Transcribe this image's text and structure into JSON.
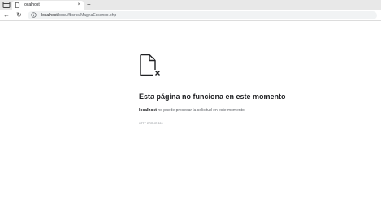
{
  "browser": {
    "tab": {
      "title": "localhost",
      "close_glyph": "×"
    },
    "new_tab_glyph": "+",
    "nav": {
      "back_glyph": "←",
      "reload_glyph": "↻"
    },
    "address": {
      "host": "localhost",
      "path": "/bosu/fbsrcs/MagnaEssenso.php"
    },
    "icons": [
      "tab-actions-icon",
      "page-favicon-icon",
      "info-icon",
      "back-arrow-icon",
      "reload-icon"
    ]
  },
  "error": {
    "icon": "broken-document-icon",
    "title": "Esta página no funciona en este momento",
    "host": "localhost",
    "message": " no puede procesar la solicitud en este momento.",
    "code": "HTTP ERROR 500"
  }
}
